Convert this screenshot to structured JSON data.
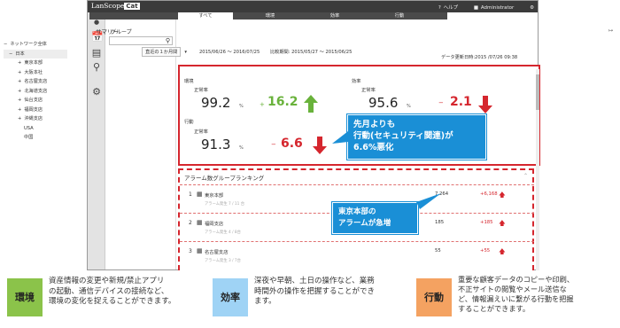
{
  "app": {
    "logo_text": "LanScope",
    "logo_badge": "Cat",
    "help": "ヘルプ",
    "user": "Administrator",
    "tools": "設定"
  },
  "sidebar": {
    "title": "グループ",
    "search_placeholder": "",
    "tree": [
      {
        "label": "ネットワーク全体",
        "level": 0,
        "marker": "−"
      },
      {
        "label": "日本",
        "level": 1,
        "marker": "−"
      },
      {
        "label": "東京本部",
        "level": 2,
        "marker": "+"
      },
      {
        "label": "大阪本社",
        "level": 2,
        "marker": "+"
      },
      {
        "label": "名古屋支店",
        "level": 2,
        "marker": "+"
      },
      {
        "label": "北海道支店",
        "level": 2,
        "marker": "+"
      },
      {
        "label": "仙台支店",
        "level": 2,
        "marker": "+"
      },
      {
        "label": "福岡支店",
        "level": 2,
        "marker": "+"
      },
      {
        "label": "沖縄支店",
        "level": 2,
        "marker": "+"
      },
      {
        "label": "USA",
        "level": 3,
        "marker": ""
      },
      {
        "label": "中国",
        "level": 3,
        "marker": ""
      }
    ]
  },
  "tabs": [
    "すべて",
    "環境",
    "効率",
    "行動"
  ],
  "main": {
    "title": "サマリー",
    "period_select": "直近の１か月間",
    "period_range": "2015/06/26 ～ 2016/07/25",
    "compare_label": "比較期間: 2015/05/27 ～ 2015/06/25",
    "updated": "データ更新日時:2015 /07/26 09:38"
  },
  "kpis": [
    {
      "label": "環境",
      "sublabel": "正常率",
      "value": "99.2",
      "unit": "%",
      "sign": "+",
      "delta": "16.2",
      "direction": "up",
      "color": "#69b23b"
    },
    {
      "label": "効率",
      "sublabel": "正常率",
      "value": "95.6",
      "unit": "%",
      "sign": "−",
      "delta": "2.1",
      "direction": "down",
      "color": "#d5262e"
    },
    {
      "label": "行動",
      "sublabel": "正常率",
      "value": "91.3",
      "unit": "%",
      "sign": "−",
      "delta": "6.6",
      "direction": "down",
      "color": "#d5262e"
    }
  ],
  "callouts": {
    "action": [
      "先月よりも",
      "行動(セキュリティ関連)が",
      "6.6%悪化"
    ],
    "alarm": [
      "東京本部の",
      "アラームが急増"
    ]
  },
  "ranking": {
    "title": "アラーム数グループランキング",
    "rows": [
      {
        "rank": "1",
        "name": "東京本部",
        "sub": "アラーム発生 7 / 11 台",
        "count": "7,264",
        "delta": "+6,168"
      },
      {
        "rank": "2",
        "name": "福岡支店",
        "sub": "アラーム発生 4 / 8台",
        "count": "185",
        "delta": "+185"
      },
      {
        "rank": "3",
        "name": "名古屋支店",
        "sub": "アラーム発生 3 / 7台",
        "count": "55",
        "delta": "+55"
      }
    ]
  },
  "legend": [
    {
      "label": "環境",
      "color": "#8bc34a",
      "text": [
        "資産情報の変更や新規/禁止アプリ",
        "の起動、通信デバイスの接続など、",
        "環境の変化を捉えることができます。"
      ]
    },
    {
      "label": "効率",
      "color": "#9fd3f5",
      "text": [
        "深夜や早朝、土日の操作など、業務",
        "時間外の操作を把握することができ",
        "ます。"
      ]
    },
    {
      "label": "行動",
      "color": "#f4a261",
      "text": [
        "重要な顧客データのコピーや印刷、",
        "不正サイトの閲覧やメール送信な",
        "ど、情報漏えいに繋がる行動を把握",
        "することができます。"
      ]
    }
  ]
}
